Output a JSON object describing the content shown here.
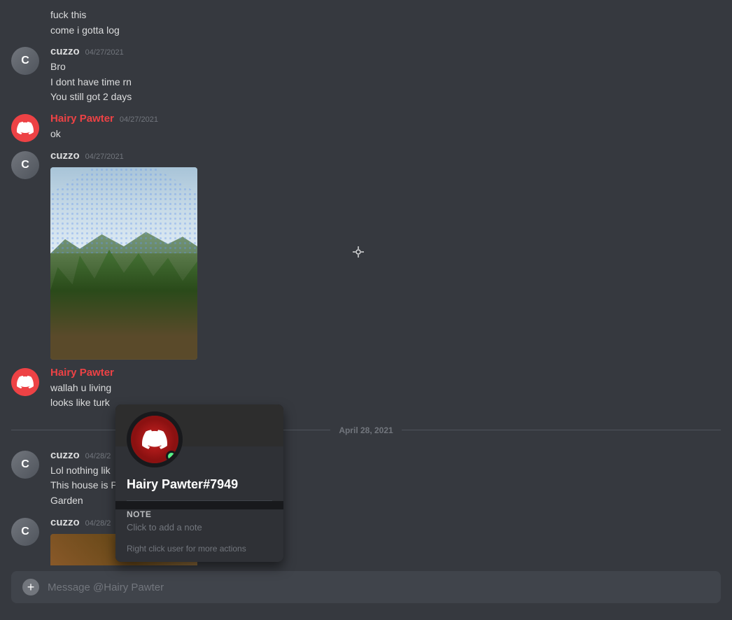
{
  "colors": {
    "bg": "#36393f",
    "bg_dark": "#2f3136",
    "bg_darkest": "#18191c",
    "text_primary": "#dcddde",
    "text_secondary": "#72767d",
    "text_link": "#00b0f4",
    "username_hairy": "#ed4245",
    "username_cuzzo": "#dcddde",
    "online": "#57f287",
    "accent": "#ed4245"
  },
  "messages": [
    {
      "id": "msg1",
      "type": "continuation",
      "text_lines": [
        "fuck this",
        "come i gotta log"
      ]
    },
    {
      "id": "msg2",
      "type": "group",
      "username": "cuzzo",
      "username_type": "cuzzo",
      "timestamp": "04/27/2021",
      "avatar_type": "user",
      "text_lines": [
        "Bro",
        "I dont have time rn",
        "You still got 2 days"
      ]
    },
    {
      "id": "msg3",
      "type": "group",
      "username": "Hairy Pawter",
      "username_type": "hairy",
      "timestamp": "04/27/2021",
      "avatar_type": "discord",
      "text_lines": [
        "ok"
      ]
    },
    {
      "id": "msg4",
      "type": "group",
      "username": "cuzzo",
      "username_type": "cuzzo",
      "timestamp": "04/27/2021",
      "avatar_type": "user",
      "has_image": true,
      "text_lines": []
    },
    {
      "id": "msg5",
      "type": "group",
      "username": "Hairy Pawter",
      "username_type": "hairy",
      "timestamp": "",
      "avatar_type": "discord",
      "text_lines": [
        "wallah u living",
        "looks like turk"
      ]
    },
    {
      "id": "msg_date",
      "type": "date_divider",
      "text": "April 28, 2021"
    },
    {
      "id": "msg6",
      "type": "group",
      "username": "cuzzo",
      "username_type": "cuzzo",
      "timestamp": "04/28/2",
      "avatar_type": "user",
      "text_lines": [
        "Lol nothing lik",
        "This house is P",
        "Garden"
      ]
    },
    {
      "id": "msg7",
      "type": "group",
      "username": "cuzzo",
      "username_type": "cuzzo",
      "timestamp": "04/28/2",
      "avatar_type": "user",
      "has_image2": true,
      "text_lines": []
    }
  ],
  "profile_popup": {
    "username": "Hairy Pawter",
    "discriminator": "#7949",
    "note_label": "NOTE",
    "note_placeholder": "Click to add a note",
    "right_click_hint": "Right click user for more actions"
  },
  "message_input": {
    "placeholder": "Message @Hairy Pawter"
  }
}
